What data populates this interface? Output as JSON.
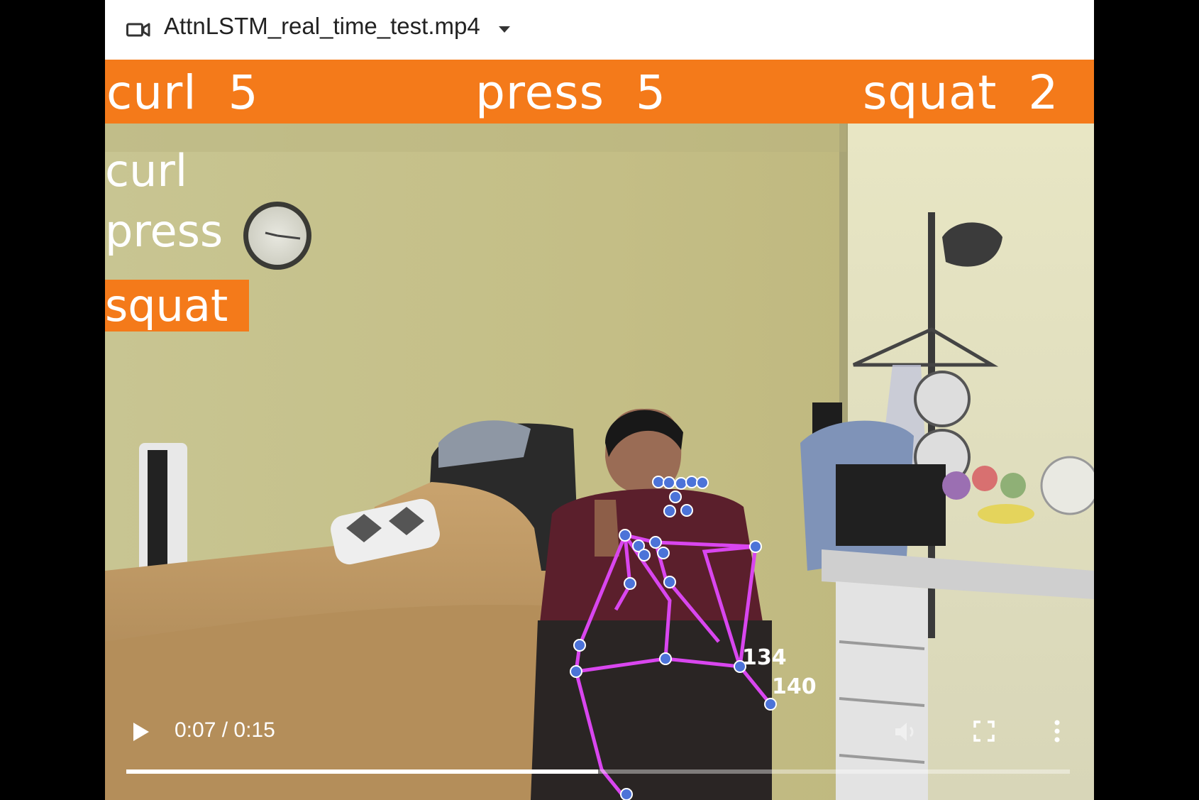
{
  "topbar": {
    "icon": "video-camera-icon",
    "filename": "AttnLSTM_real_time_test.mp4",
    "dropdown_icon": "chevron-down-icon"
  },
  "overlay": {
    "counters": [
      {
        "exercise": "curl",
        "count": "5"
      },
      {
        "exercise": "press",
        "count": "5"
      },
      {
        "exercise": "squat",
        "count": "2"
      }
    ],
    "labels": [
      "curl",
      "press",
      "squat"
    ],
    "active_label": "squat",
    "angles": [
      "134",
      "140"
    ],
    "accent_color": "#f47a1a"
  },
  "player": {
    "play_icon": "play-icon",
    "time_display": "0:07 / 0:15",
    "progress": 0.5,
    "volume_icon": "volume-icon",
    "fullscreen_icon": "fullscreen-icon",
    "more_icon": "more-vertical-icon"
  }
}
